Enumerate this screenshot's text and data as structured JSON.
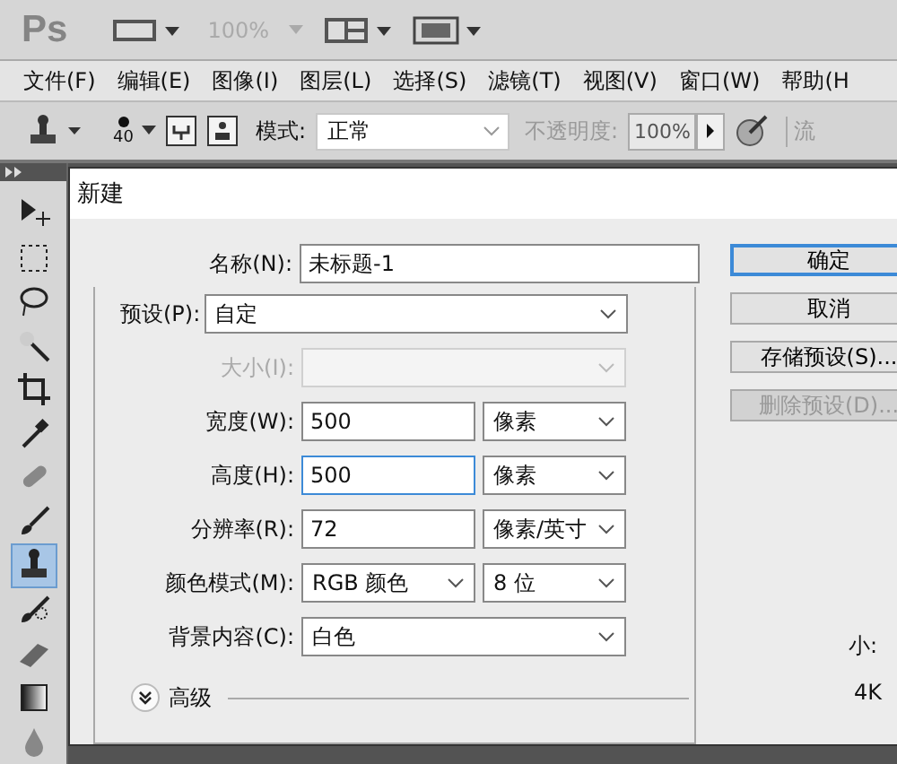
{
  "app_bar": {
    "logo": "Ps",
    "zoom": "100%"
  },
  "menu": [
    {
      "label": "文件(F)"
    },
    {
      "label": "编辑(E)"
    },
    {
      "label": "图像(I)"
    },
    {
      "label": "图层(L)"
    },
    {
      "label": "选择(S)"
    },
    {
      "label": "滤镜(T)"
    },
    {
      "label": "视图(V)"
    },
    {
      "label": "窗口(W)"
    },
    {
      "label": "帮助(H"
    }
  ],
  "options_bar": {
    "brush_size": "40",
    "mode_label": "模式:",
    "mode_value": "正常",
    "opacity_label": "不透明度:",
    "opacity_value": "100%",
    "flow_label": "流"
  },
  "tools": [
    {
      "kind": "move",
      "selected": false
    },
    {
      "kind": "marquee",
      "selected": false
    },
    {
      "kind": "lasso",
      "selected": false
    },
    {
      "kind": "wand",
      "selected": false
    },
    {
      "kind": "crop",
      "selected": false
    },
    {
      "kind": "eyedropper",
      "selected": false
    },
    {
      "kind": "healing",
      "selected": false
    },
    {
      "kind": "brush",
      "selected": false
    },
    {
      "kind": "stamp",
      "selected": true
    },
    {
      "kind": "history",
      "selected": false
    },
    {
      "kind": "eraser",
      "selected": false
    },
    {
      "kind": "gradient",
      "selected": false
    },
    {
      "kind": "drop",
      "selected": false
    }
  ],
  "dialog": {
    "title": "新建",
    "name": {
      "label": "名称(N):",
      "value": "未标题-1"
    },
    "preset": {
      "label": "预设(P):",
      "value": "自定"
    },
    "fields": [
      {
        "kind": "select",
        "label": "大小(I):",
        "disabled": true
      },
      {
        "kind": "text",
        "label": "宽度(W):",
        "value": "500",
        "unit": "像素",
        "disabled": false
      },
      {
        "kind": "text",
        "label": "高度(H):",
        "value": "500",
        "unit": "像素",
        "disabled": false,
        "focused": true
      },
      {
        "kind": "text",
        "label": "分辨率(R):",
        "value": "72",
        "unit": "像素/英寸",
        "disabled": false
      },
      {
        "kind": "select",
        "label": "颜色模式(M):",
        "value": "RGB 颜色",
        "unit": "8 位",
        "disabled": false
      },
      {
        "kind": "wide",
        "label": "背景内容(C):",
        "value": "白色",
        "disabled": false
      }
    ],
    "advanced": "高级",
    "buttons": [
      {
        "label": "确定",
        "kind": "default"
      },
      {
        "label": "取消",
        "kind": "normal"
      },
      {
        "label": "存储预设(S)...",
        "kind": "normal"
      },
      {
        "label": "删除预设(D)...",
        "kind": "disabled"
      }
    ],
    "image_size": {
      "label": "小:",
      "value": "4K"
    }
  }
}
